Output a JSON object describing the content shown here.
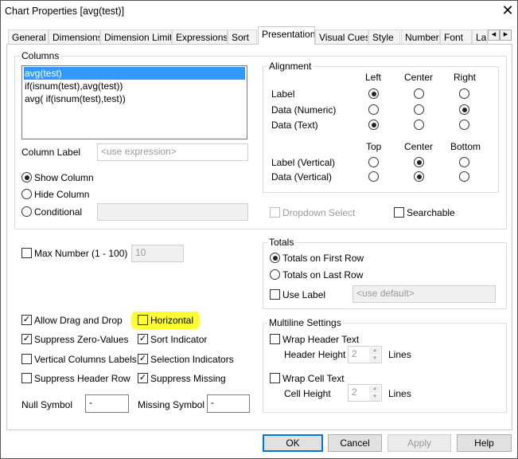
{
  "window": {
    "title": "Chart Properties [avg(test)]",
    "close": "✕"
  },
  "tabs": [
    "General",
    "Dimensions",
    "Dimension Limits",
    "Expressions",
    "Sort",
    "Presentation",
    "Visual Cues",
    "Style",
    "Number",
    "Font",
    "La"
  ],
  "tab_scroll": {
    "left": "◀",
    "right": "▶"
  },
  "columns": {
    "label": "Columns",
    "items": [
      "avg(test)",
      "if(isnum(test),avg(test))",
      "avg( if(isnum(test),test))"
    ],
    "column_label": "Column Label",
    "column_label_placeholder": "<use expression>",
    "show": "Show Column",
    "hide": "Hide Column",
    "conditional": "Conditional"
  },
  "alignment": {
    "label": "Alignment",
    "h_headers": [
      "Left",
      "Center",
      "Right"
    ],
    "rows": [
      "Label",
      "Data (Numeric)",
      "Data (Text)"
    ],
    "v_headers": [
      "Top",
      "Center",
      "Bottom"
    ],
    "v_rows": [
      "Label (Vertical)",
      "Data (Vertical)"
    ]
  },
  "dropdown_select": "Dropdown Select",
  "searchable": "Searchable",
  "max_number": {
    "label": "Max Number (1 - 100)",
    "value": "10"
  },
  "totals": {
    "label": "Totals",
    "first": "Totals on First Row",
    "last": "Totals on Last Row",
    "use_label": "Use Label",
    "placeholder": "<use default>"
  },
  "options": {
    "allow_drag": "Allow Drag and Drop",
    "horizontal": "Horizontal",
    "suppress_zero": "Suppress Zero-Values",
    "sort_indicator": "Sort Indicator",
    "vertical_labels": "Vertical Columns Labels",
    "selection_indicators": "Selection Indicators",
    "suppress_header": "Suppress Header Row",
    "suppress_missing": "Suppress Missing"
  },
  "null_symbol": {
    "label": "Null Symbol",
    "value": "-"
  },
  "missing_symbol": {
    "label": "Missing Symbol",
    "value": "-"
  },
  "multiline": {
    "label": "Multiline Settings",
    "wrap_header": "Wrap Header Text",
    "header_height": "Header Height",
    "header_value": "2",
    "wrap_cell": "Wrap Cell Text",
    "cell_height": "Cell Height",
    "cell_value": "2",
    "lines": "Lines"
  },
  "buttons": {
    "ok": "OK",
    "cancel": "Cancel",
    "apply": "Apply",
    "help": "Help"
  },
  "highlight_color": "#ffff33"
}
